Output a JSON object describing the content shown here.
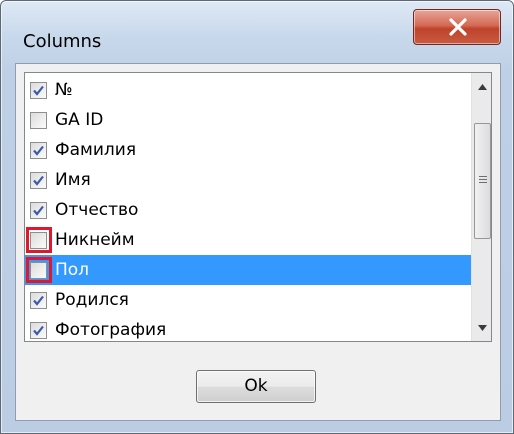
{
  "window": {
    "title": "Columns",
    "close_symbol": "x"
  },
  "columns_list": {
    "items": [
      {
        "label": "№",
        "checked": true
      },
      {
        "label": "GA ID",
        "checked": false
      },
      {
        "label": "Фамилия",
        "checked": true
      },
      {
        "label": "Имя",
        "checked": true
      },
      {
        "label": "Отчество",
        "checked": true
      },
      {
        "label": "Никнейм",
        "checked": false
      },
      {
        "label": "Пол",
        "checked": false
      },
      {
        "label": "Родился",
        "checked": true
      },
      {
        "label": "Фотография",
        "checked": true
      }
    ],
    "selected_label": "Пол"
  },
  "buttons": {
    "ok_label": "Ok"
  },
  "colors": {
    "selection": "#3399ff",
    "highlight_box": "#e0182d",
    "checkmark": "#3d5aa8"
  },
  "icons": {
    "close": "close-x-icon",
    "check": "checkmark-icon",
    "scroll_up": "arrow-up-icon",
    "scroll_down": "arrow-down-icon",
    "thumb_grip": "grip-icon"
  }
}
